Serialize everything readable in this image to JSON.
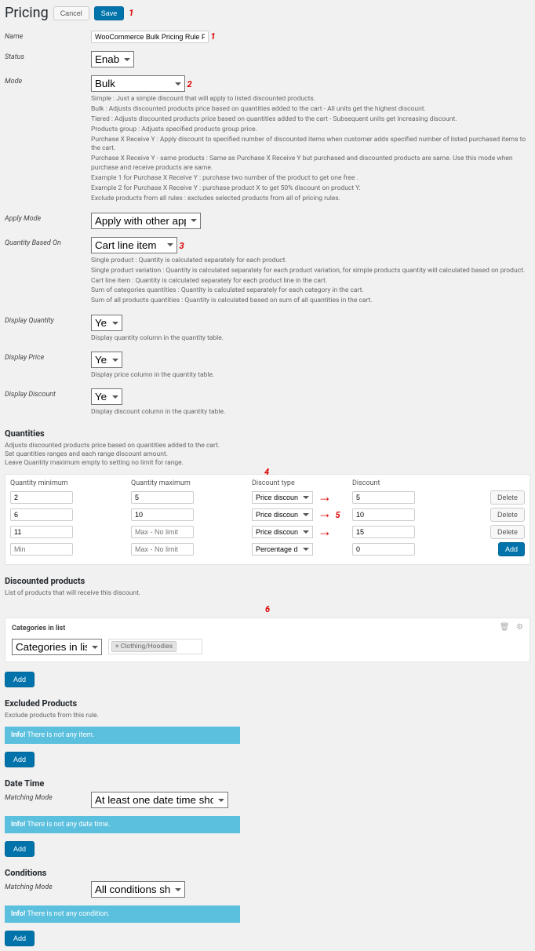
{
  "header": {
    "title": "Pricing",
    "cancel": "Cancel",
    "save": "Save",
    "ann1": "1"
  },
  "name": {
    "label": "Name",
    "value": "WooCommerce Bulk Pricing Rule For Category",
    "ann": "1"
  },
  "status": {
    "label": "Status",
    "value": "Enabled"
  },
  "mode": {
    "label": "Mode",
    "value": "Bulk",
    "ann": "2",
    "help": [
      "Simple : Just a simple discount that will apply to listed discounted products.",
      "Bulk : Adjusts discounted products price based on quantities added to the cart - All units get the highest discount.",
      "Tiered : Adjusts discounted products price based on quantities added to the cart - Subsequent units get increasing discount.",
      "Products group : Adjusts specified products group price.",
      "Purchase X Receive Y : Apply discount to specified number of discounted items when customer adds specified number of listed purchased items to the cart.",
      "Purchase X Receive Y - same products : Same as Purchase X Receive Y but purchased and discounted products are same. Use this mode when purchase and receive products are same.",
      "Example 1 for Purchase X Receive Y : purchase two number of the product to get one free .",
      "Example 2 for Purchase X Receive Y : purchase product X to get 50% discount on product Y.",
      "Exclude products from all rules : excludes selected products from all of pricing rules."
    ]
  },
  "applyMode": {
    "label": "Apply Mode",
    "value": "Apply with other applicable rules"
  },
  "qtyBased": {
    "label": "Quantity Based On",
    "value": "Cart line item",
    "ann": "3",
    "help": [
      "Single product : Quantity is calculated separately for each product.",
      "Single product variation : Quantity is calculated separately for each product variation, for simple products quantity will calculated based on product.",
      "Cart line item : Quantity is calculated separately for each product line in the cart.",
      "Sum of categories quantities : Quantity is calculated separately for each category in the cart.",
      "Sum of all products quantities : Quantity is calculated based on sum of all quantities in the cart."
    ]
  },
  "dispQty": {
    "label": "Display Quantity",
    "value": "Yes",
    "help": "Display quantity column in the quantity table."
  },
  "dispPrice": {
    "label": "Display Price",
    "value": "Yes",
    "help": "Display price column in the quantity table."
  },
  "dispDisc": {
    "label": "Display Discount",
    "value": "Yes",
    "help": "Display discount column in the quantity table."
  },
  "quantities": {
    "title": "Quantities",
    "sub": "Adjusts discounted products price based on quantities added to the cart.\nSet quantities ranges and each range discount amount.\nLeave Quantity maximum empty to setting no limit for range.",
    "ann4": "4",
    "ann5": "5",
    "cols": {
      "min": "Quantity minimum",
      "max": "Quantity maximum",
      "type": "Discount type",
      "disc": "Discount"
    },
    "rows": [
      {
        "min": "2",
        "max": "5",
        "type": "Price discount",
        "disc": "5",
        "act": "Delete"
      },
      {
        "min": "6",
        "max": "10",
        "type": "Price discount",
        "disc": "10",
        "act": "Delete"
      },
      {
        "min": "11",
        "max": "",
        "maxPh": "Max - No limit",
        "type": "Price discount",
        "disc": "15",
        "act": "Delete"
      },
      {
        "min": "",
        "minPh": "Min",
        "max": "",
        "maxPh": "Max - No limit",
        "type": "Percentage discount",
        "disc": "0",
        "act": "Add"
      }
    ]
  },
  "discProd": {
    "title": "Discounted products",
    "sub": "List of products that will receive this discount.",
    "ann6": "6",
    "panelTitle": "Categories in list",
    "selector": "Categories in list",
    "tag": "× Clothing/Hoodies",
    "add": "Add"
  },
  "exclProd": {
    "title": "Excluded Products",
    "sub": "Exclude products from this rule.",
    "info": "There is not any item.",
    "add": "Add"
  },
  "dateTime": {
    "title": "Date Time",
    "matchLabel": "Matching Mode",
    "matchValue": "At least one date time should match",
    "info": "There is not any date time.",
    "add": "Add"
  },
  "conditions": {
    "title": "Conditions",
    "matchLabel": "Matching Mode",
    "matchValue": "All conditions should match",
    "info": "There is not any condition.",
    "add": "Add"
  },
  "infoLabel": "Info!"
}
